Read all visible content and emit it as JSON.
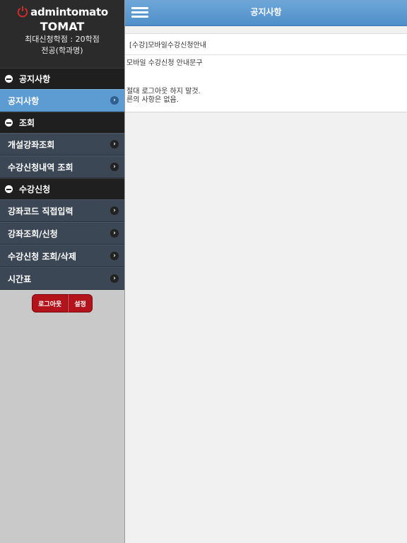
{
  "user": {
    "id": "admintomato",
    "name": "TOMAT",
    "max_credits": "최대신청학점 : 20학점",
    "major": "전공(학과명)"
  },
  "sidebar": {
    "sections": [
      {
        "title": "공지사항",
        "items": [
          {
            "label": "공지사항",
            "active": true
          }
        ]
      },
      {
        "title": "조회",
        "items": [
          {
            "label": "개설강좌조회"
          },
          {
            "label": "수강신청내역 조회"
          }
        ]
      },
      {
        "title": "수강신청",
        "items": [
          {
            "label": "강좌코드 직접입력"
          },
          {
            "label": "강좌조회/신청"
          },
          {
            "label": "수강신청 조회/삭제"
          },
          {
            "label": "시간표"
          }
        ]
      }
    ],
    "logout_label": "로그아웃",
    "settings_label": "설정"
  },
  "header": {
    "title": "공지사항"
  },
  "notice": {
    "title": "[수강]모바일수강신청안내",
    "lines": [
      "모바일 수강신청 안내문구",
      "절대 로그아웃 하지 말것.",
      "른의 사항은 없음."
    ]
  },
  "colors": {
    "accent": "#5d9bd3",
    "nav_bg": "#3b4755",
    "section_bg": "#1f1f1f",
    "button_red": "#b3131a"
  }
}
